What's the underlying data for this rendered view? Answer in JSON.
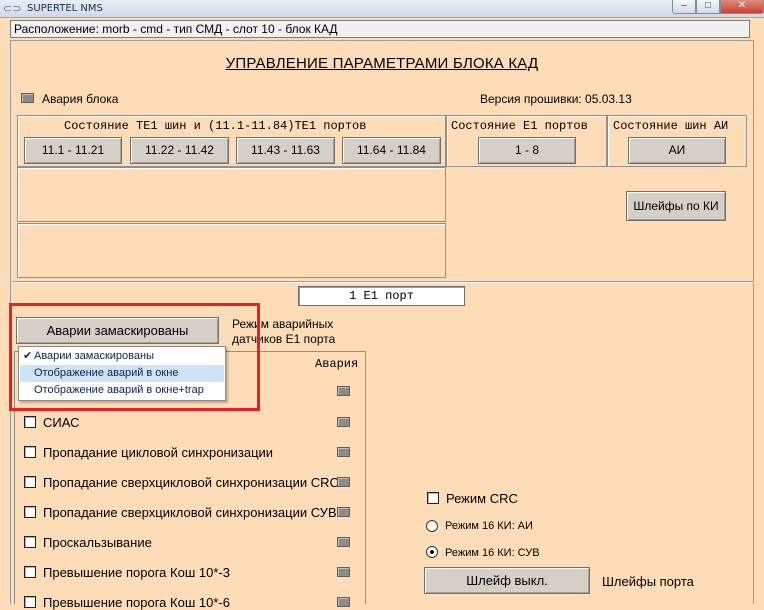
{
  "window": {
    "title": "SUPERTEL NMS",
    "min_glyph": "‒",
    "max_glyph": "□",
    "close_glyph": "✕",
    "icon": "app-icon"
  },
  "location": "Расположение: morb - cmd - тип СМД - слот 10 - блок КАД",
  "page_title": "УПРАВЛЕНИЕ ПАРАМЕТРАМИ БЛОКА КАД",
  "block_alarm_label": "Авария блока",
  "firmware": "Версия прошивки: 05.03.13",
  "te1_group": {
    "title": "Состояние TE1 шин и (11.1-11.84)TE1 портов",
    "buttons": [
      "11.1 - 11.21",
      "11.22 - 11.42",
      "11.43 - 11.63",
      "11.64 - 11.84"
    ]
  },
  "e1_group": {
    "title": "Состояние E1 портов",
    "button": "1 - 8"
  },
  "ai_group": {
    "title": "Состояние шин АИ",
    "button": "АИ"
  },
  "ki_loops_button": "Шлейфы по КИ",
  "port_field": "1 E1 порт",
  "mask_dropdown": {
    "selected": "Аварии замаскированы",
    "options": [
      "Аварии замаскированы",
      "Отображение аварий в окне",
      "Отображение аварий в окне+trap"
    ],
    "checked_index": 0,
    "hover_index": 1,
    "check_glyph": "✔"
  },
  "alarm_mode_label": "Режим аварийных датчиков E1 порта",
  "alarm_column_header": "Авария",
  "alarm_rows": [
    "СИАС",
    "Пропадание цикловой синхронизации",
    "Пропадание сверхцикловой синхронизации CRC",
    "Пропадание сверхцикловой синхронизации СУВ",
    "Проскальзывание",
    "Превышение порога Кош 10*-3",
    "Превышение порога Кош 10*-6"
  ],
  "crc_mode_label": "Режим CRC",
  "radio_options": [
    {
      "label": "Режим 16 КИ: АИ",
      "selected": false
    },
    {
      "label": "Режим 16 КИ: СУВ",
      "selected": true
    }
  ],
  "loop_button": "Шлейф выкл.",
  "port_loops_label": "Шлейфы порта",
  "colors": {
    "panel_bg": "#ffdcb8",
    "button_bg": "#d4d0c8",
    "highlight": "#ee1c25",
    "alarm_led": "#8c8c8c",
    "menu_hover": "#cfe3f7"
  }
}
